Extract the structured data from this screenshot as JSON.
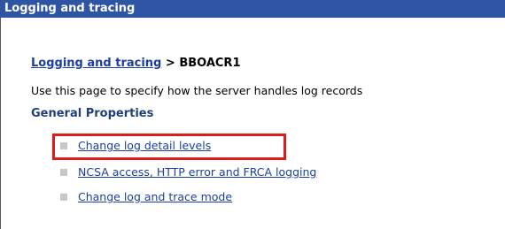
{
  "panel": {
    "title": "Logging and tracing"
  },
  "breadcrumb": {
    "link": "Logging and tracing",
    "separator": ">",
    "current": "BBOACR1"
  },
  "description": "Use this page to specify how the server handles log records",
  "general_properties": {
    "heading": "General Properties",
    "links": [
      {
        "label": "Change log detail levels",
        "highlighted": true
      },
      {
        "label": "NCSA access, HTTP error and FRCA logging",
        "highlighted": false
      },
      {
        "label": "Change log and trace mode",
        "highlighted": false
      }
    ]
  },
  "colors": {
    "title_bar": "#2e55a4",
    "link": "#1b3fa0",
    "section_heading": "#1f3f7a",
    "highlight_border": "#e01b1b",
    "bullet": "#c8c8c8"
  }
}
